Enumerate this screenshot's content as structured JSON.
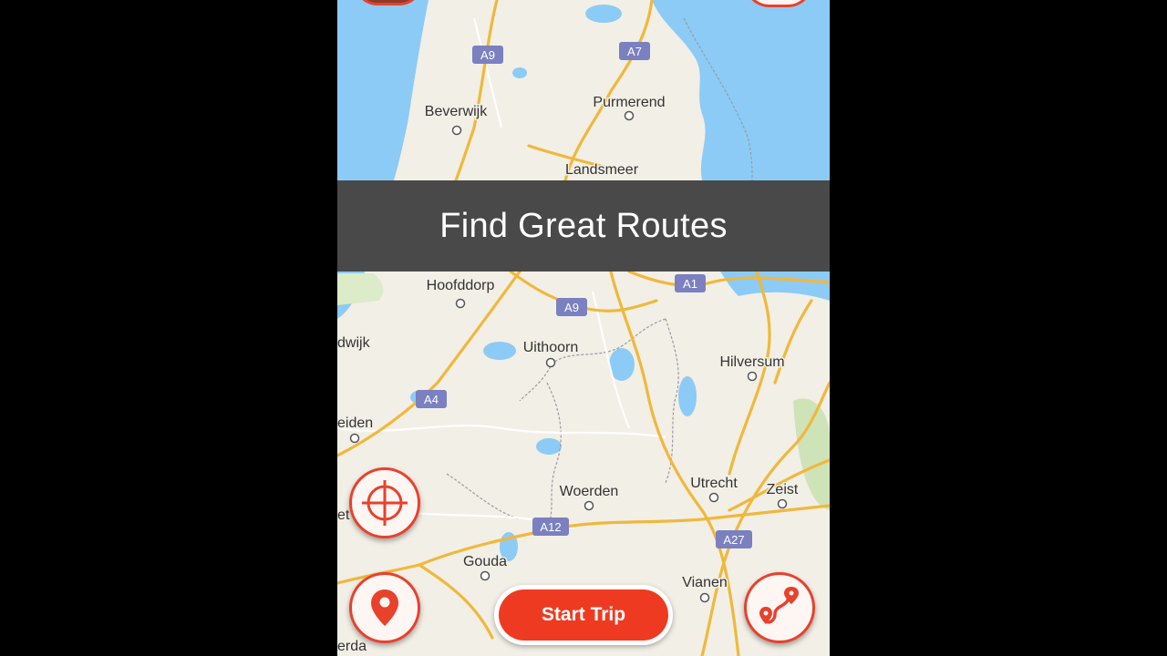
{
  "banner": {
    "title": "Find Great Routes"
  },
  "start_trip": {
    "label": "Start Trip"
  },
  "icons": {
    "locate": "crosshair-icon",
    "pin": "location-pin-icon",
    "route": "route-icon"
  },
  "colors": {
    "accent": "#e8412c",
    "water": "#8ccbf5",
    "land": "#f2efe6",
    "motorway": "#f0b83c"
  },
  "map": {
    "places": [
      "Beverwijk",
      "Purmerend",
      "Landsmeer",
      "Hoofddorp",
      "Uithoorn",
      "Hilversum",
      "dwijk",
      "eiden",
      "Woerden",
      "Utrecht",
      "Zeist",
      "Gouda",
      "Vianen",
      "et",
      "erda"
    ],
    "roads": [
      "A9",
      "A7",
      "A1",
      "A9",
      "A4",
      "A12",
      "A27"
    ]
  }
}
